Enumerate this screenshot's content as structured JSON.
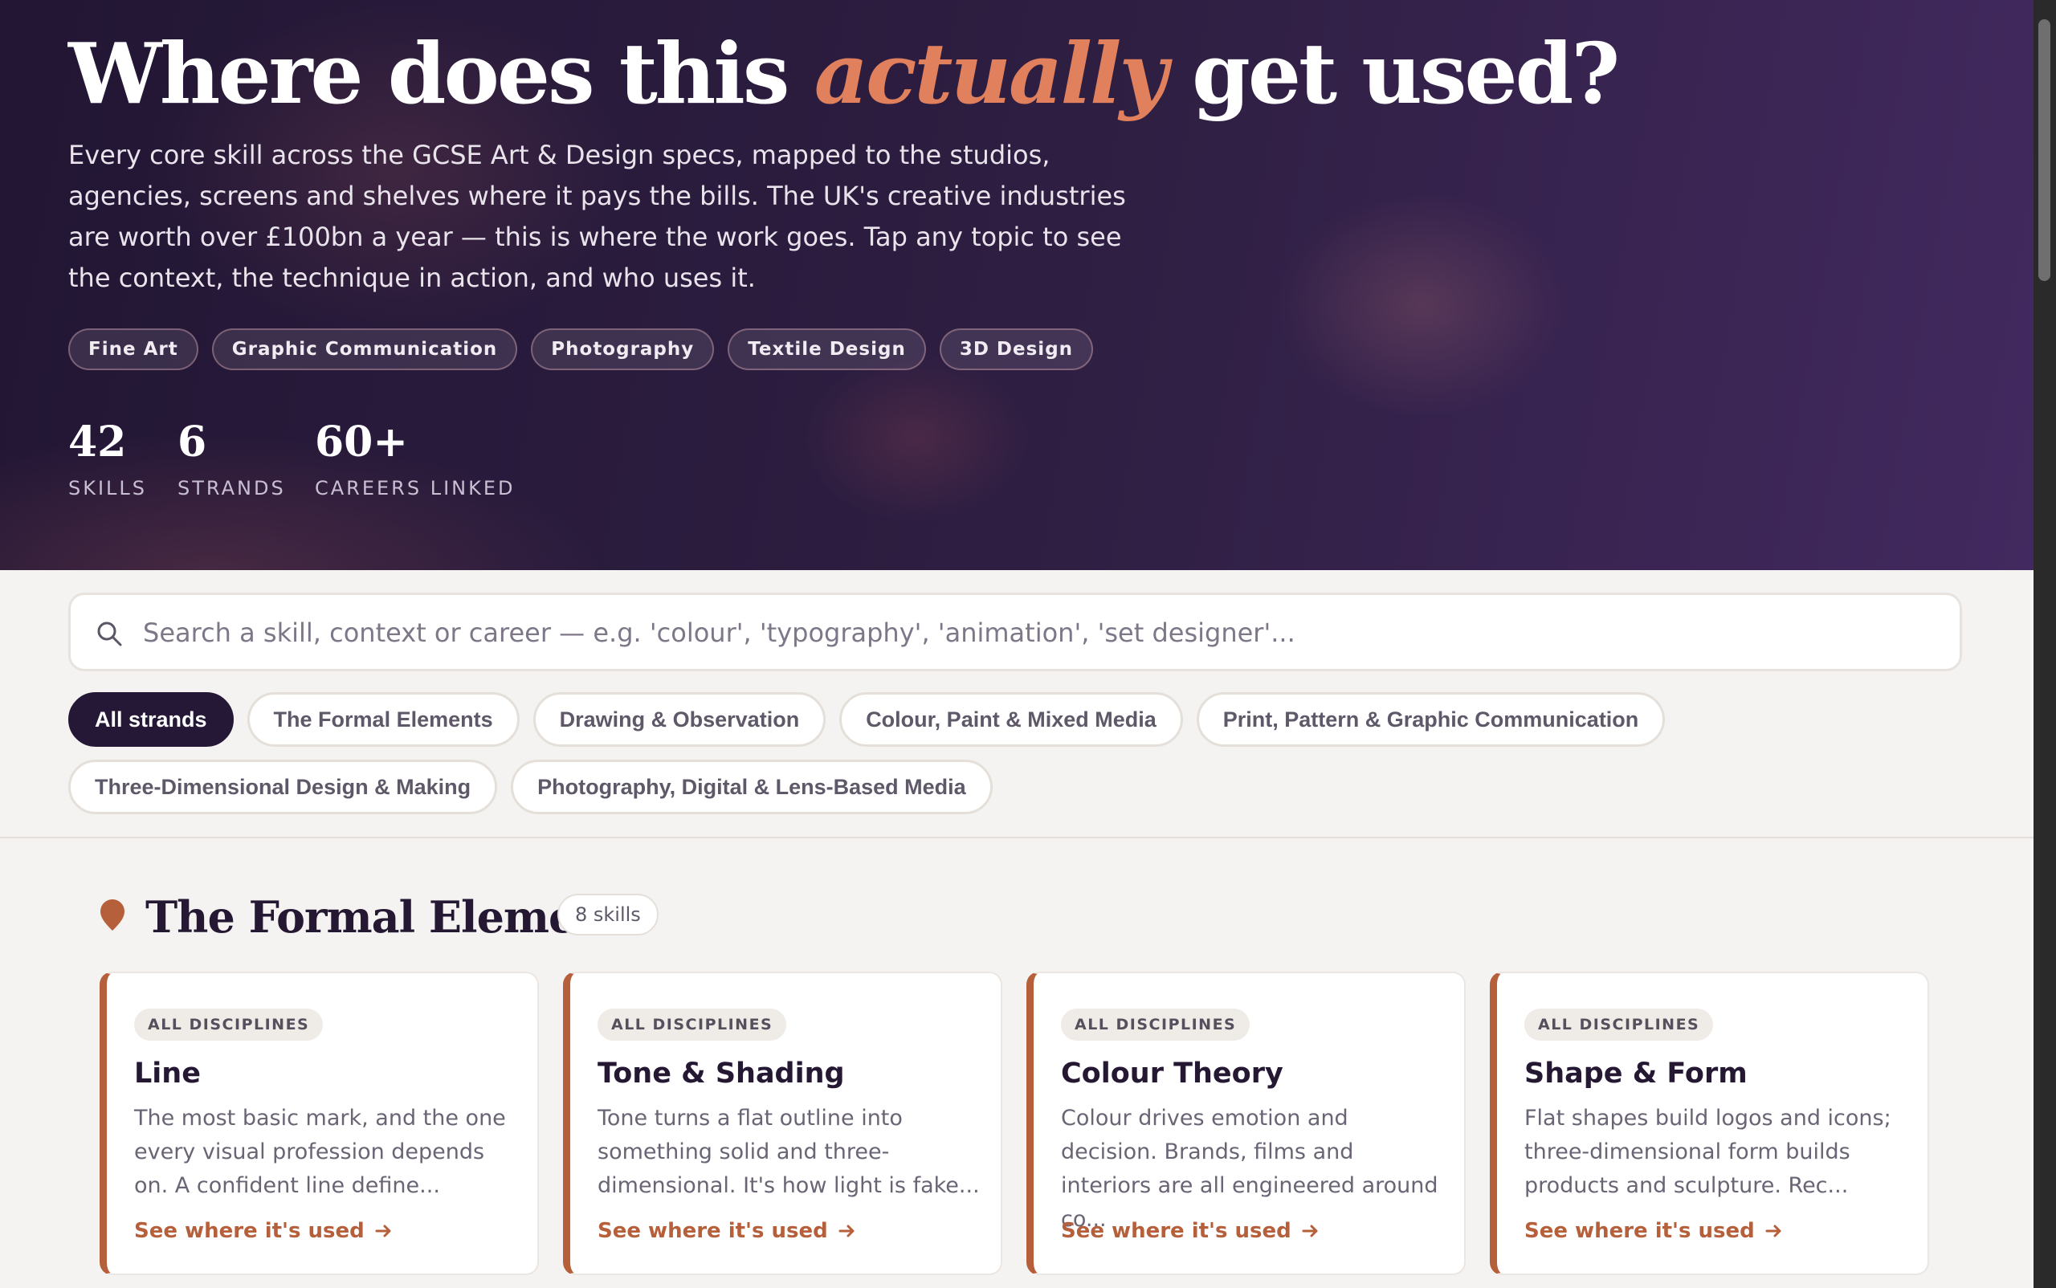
{
  "hero": {
    "title_before": "Where does this ",
    "title_accent": "actually",
    "title_after": " get used?",
    "description": "Every core skill across the GCSE Art & Design specs, mapped to the studios, agencies, screens and shelves where it pays the bills. The UK's creative industries are worth over £100bn a year — this is where the work goes. Tap any topic to see the context, the technique in action, and who uses it.",
    "disciplines": [
      "Fine Art",
      "Graphic Communication",
      "Photography",
      "Textile Design",
      "3D Design"
    ],
    "stats": [
      {
        "value": "42",
        "label": "SKILLS"
      },
      {
        "value": "6",
        "label": "STRANDS"
      },
      {
        "value": "60+",
        "label": "CAREERS LINKED"
      }
    ]
  },
  "search": {
    "placeholder": "Search a skill, context or career — e.g. 'colour', 'typography', 'animation', 'set designer'...",
    "value": "",
    "icon": "search-icon"
  },
  "filters": [
    {
      "label": "All strands",
      "active": true
    },
    {
      "label": "The Formal Elements",
      "active": false
    },
    {
      "label": "Drawing & Observation",
      "active": false
    },
    {
      "label": "Colour, Paint & Mixed Media",
      "active": false
    },
    {
      "label": "Print, Pattern & Graphic Communication",
      "active": false
    },
    {
      "label": "Three-Dimensional Design & Making",
      "active": false
    },
    {
      "label": "Photography, Digital & Lens-Based Media",
      "active": false
    }
  ],
  "section": {
    "title": "The Formal Elements",
    "count": "8 skills",
    "marker_color": "#b65f3b"
  },
  "cards": [
    {
      "tag": "ALL DISCIPLINES",
      "title": "Line",
      "description": "The most basic mark, and the one every visual profession depends on. A confident line define...",
      "link": "See where it's used"
    },
    {
      "tag": "ALL DISCIPLINES",
      "title": "Tone & Shading",
      "description": "Tone turns a flat outline into something solid and three-dimensional. It's how light is fake...",
      "link": "See where it's used"
    },
    {
      "tag": "ALL DISCIPLINES",
      "title": "Colour Theory",
      "description": "Colour drives emotion and decision. Brands, films and interiors are all engineered around co...",
      "link": "See where it's used"
    },
    {
      "tag": "ALL DISCIPLINES",
      "title": "Shape & Form",
      "description": "Flat shapes build logos and icons; three-dimensional form builds products and sculpture. Rec...",
      "link": "See where it's used"
    }
  ],
  "colors": {
    "hero_dark": "#221634",
    "hero_purple": "#42295f",
    "accent": "#e0805d",
    "link": "#b65f3b",
    "active_chip": "#251836"
  }
}
